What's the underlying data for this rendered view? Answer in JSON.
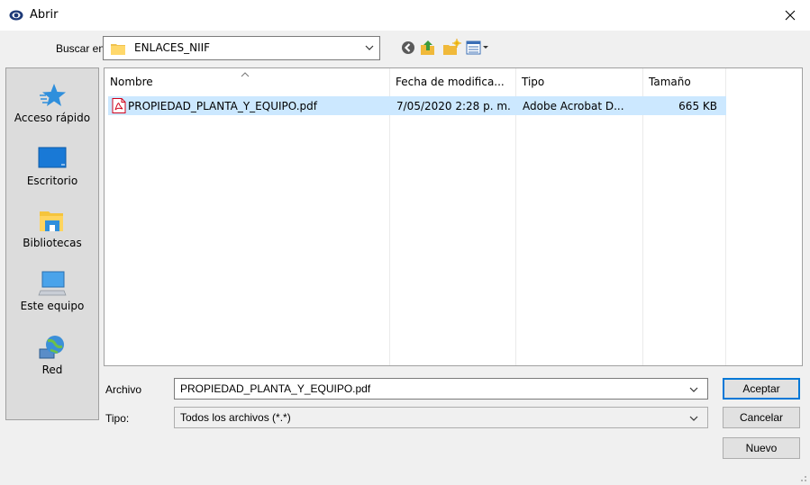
{
  "window": {
    "title": "Abrir"
  },
  "lookin": {
    "label": "Buscar en:",
    "value": "ENLACES_NIIF"
  },
  "places": [
    {
      "label": "Acceso rápido",
      "icon": "star-icon"
    },
    {
      "label": "Escritorio",
      "icon": "desktop-icon"
    },
    {
      "label": "Bibliotecas",
      "icon": "libraries-icon"
    },
    {
      "label": "Este equipo",
      "icon": "computer-icon"
    },
    {
      "label": "Red",
      "icon": "network-icon"
    }
  ],
  "columns": [
    "Nombre",
    "Fecha de modifica...",
    "Tipo",
    "Tamaño"
  ],
  "files": [
    {
      "name": "PROPIEDAD_PLANTA_Y_EQUIPO.pdf",
      "modified": "7/05/2020 2:28 p. m.",
      "type": "Adobe Acrobat D...",
      "size": "665 KB",
      "icon": "pdf-icon"
    }
  ],
  "filename": {
    "label": "Archivo",
    "value": "PROPIEDAD_PLANTA_Y_EQUIPO.pdf"
  },
  "filetype": {
    "label": "Tipo:",
    "value": "Todos los archivos (*.*)"
  },
  "buttons": {
    "ok": "Aceptar",
    "cancel": "Cancelar",
    "new": "Nuevo"
  },
  "colors": {
    "selection": "#cce8ff",
    "accent": "#0078d7",
    "pdf_red": "#d0021b"
  }
}
